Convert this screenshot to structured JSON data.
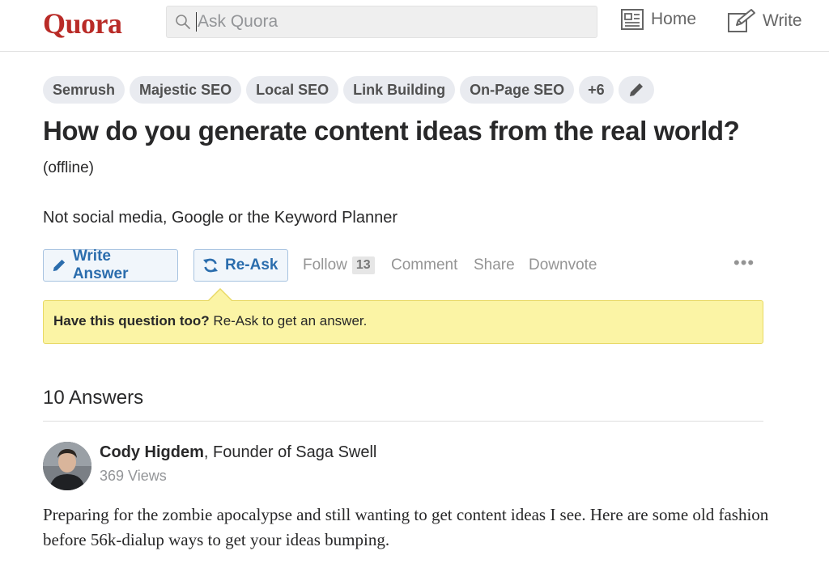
{
  "header": {
    "logo": "Quora",
    "search_placeholder": "Ask Quora",
    "nav": {
      "home": "Home",
      "write": "Write"
    }
  },
  "topics": [
    "Semrush",
    "Majestic SEO",
    "Local SEO",
    "Link Building",
    "On-Page SEO"
  ],
  "topics_more": "+6",
  "question": {
    "title": "How do you generate content ideas from the real world?",
    "subtitle": "(offline)",
    "details": "Not social media, Google or the Keyword Planner"
  },
  "actions": {
    "write_answer": "Write Answer",
    "reask": "Re-Ask",
    "follow": "Follow",
    "follow_count": "13",
    "comment": "Comment",
    "share": "Share",
    "downvote": "Downvote",
    "more": "•••"
  },
  "notice": {
    "bold": "Have this question too?",
    "text": " Re-Ask to get an answer."
  },
  "answers": {
    "count_label": "10 Answers",
    "first": {
      "author": "Cody Higdem",
      "credential": ", Founder of Saga Swell",
      "views": "369 Views",
      "text": "Preparing for the zombie apocalypse and still wanting to get content ideas I see.  Here are some old fashion before 56k-dialup ways to get your ideas bumping."
    }
  },
  "colors": {
    "brand": "#b92b27",
    "link_blue": "#2b6dad",
    "notice_bg": "#fbf4a5"
  }
}
